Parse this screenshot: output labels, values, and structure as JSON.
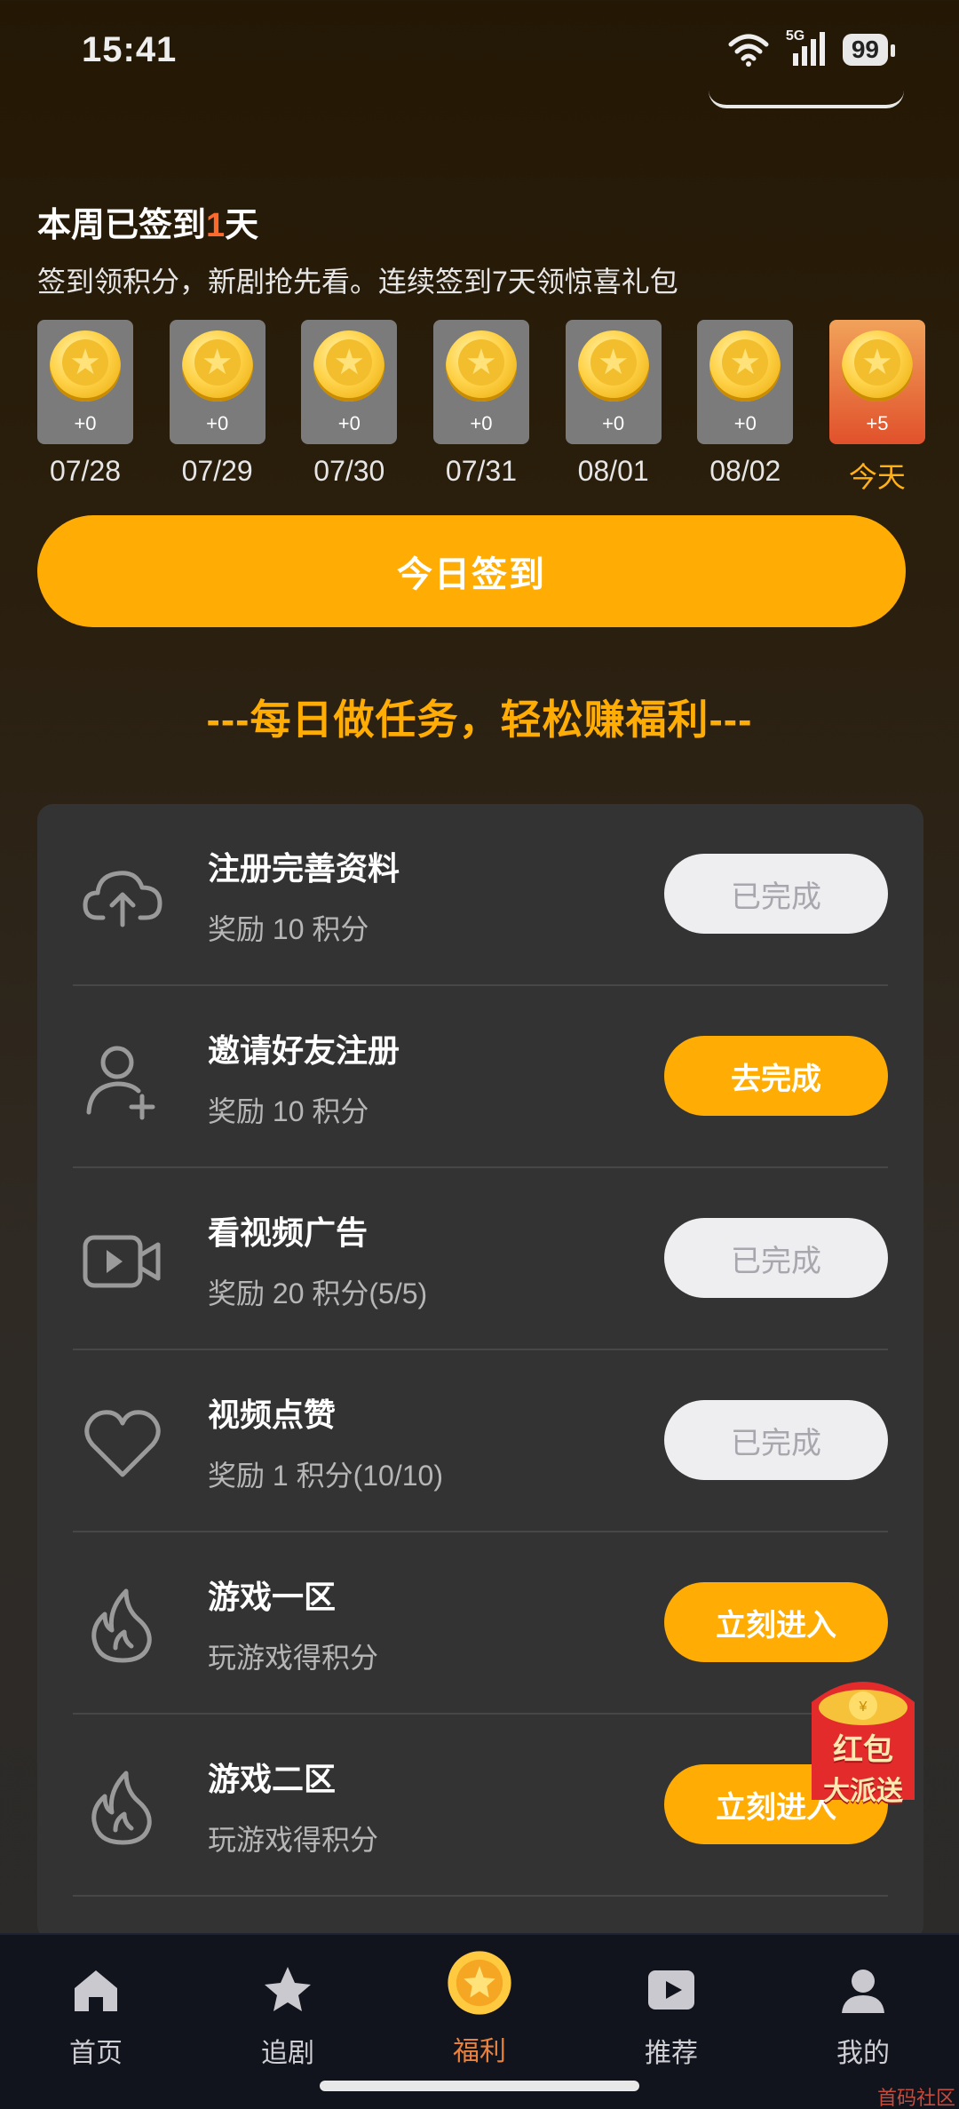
{
  "status_bar": {
    "time": "15:41",
    "network": "5G",
    "battery": "99"
  },
  "signin": {
    "title_prefix": "本周已签到",
    "count": "1",
    "title_suffix": "天",
    "description": "签到领积分，新剧抢先看。连续签到7天领惊喜礼包",
    "days": [
      {
        "date": "07/28",
        "points": "+0"
      },
      {
        "date": "07/29",
        "points": "+0"
      },
      {
        "date": "07/30",
        "points": "+0"
      },
      {
        "date": "07/31",
        "points": "+0"
      },
      {
        "date": "08/01",
        "points": "+0"
      },
      {
        "date": "08/02",
        "points": "+0"
      },
      {
        "date": "今天",
        "points": "+5"
      }
    ],
    "button": "今日签到"
  },
  "tasks_heading": "---每日做任务，轻松赚福利---",
  "tasks": [
    {
      "icon": "cloud-upload-icon",
      "title": "注册完善资料",
      "subtitle": "奖励 10 积分",
      "button": "已完成",
      "state": "done"
    },
    {
      "icon": "add-user-icon",
      "title": "邀请好友注册",
      "subtitle": "奖励 10 积分",
      "button": "去完成",
      "state": "go"
    },
    {
      "icon": "video-icon",
      "title": "看视频广告",
      "subtitle": "奖励 20 积分(5/5)",
      "button": "已完成",
      "state": "done"
    },
    {
      "icon": "heart-icon",
      "title": "视频点赞",
      "subtitle": "奖励 1 积分(10/10)",
      "button": "已完成",
      "state": "done"
    },
    {
      "icon": "fire-icon",
      "title": "游戏一区",
      "subtitle": "玩游戏得积分",
      "button": "立刻进入",
      "state": "go"
    },
    {
      "icon": "fire-icon",
      "title": "游戏二区",
      "subtitle": "玩游戏得积分",
      "button": "立刻进入",
      "state": "go"
    }
  ],
  "red_envelope": {
    "line1": "红包",
    "line2": "大派送"
  },
  "nav": [
    {
      "icon": "home-icon",
      "label": "首页"
    },
    {
      "icon": "star-icon",
      "label": "追剧"
    },
    {
      "icon": "coin-icon",
      "label": "福利",
      "active": true
    },
    {
      "icon": "play-icon",
      "label": "推荐"
    },
    {
      "icon": "user-icon",
      "label": "我的"
    }
  ],
  "watermark": "首码社区",
  "colors": {
    "accent": "#ffad05",
    "highlight": "#ff6a2c",
    "active_nav": "#e8813c",
    "panel": "#333333"
  }
}
